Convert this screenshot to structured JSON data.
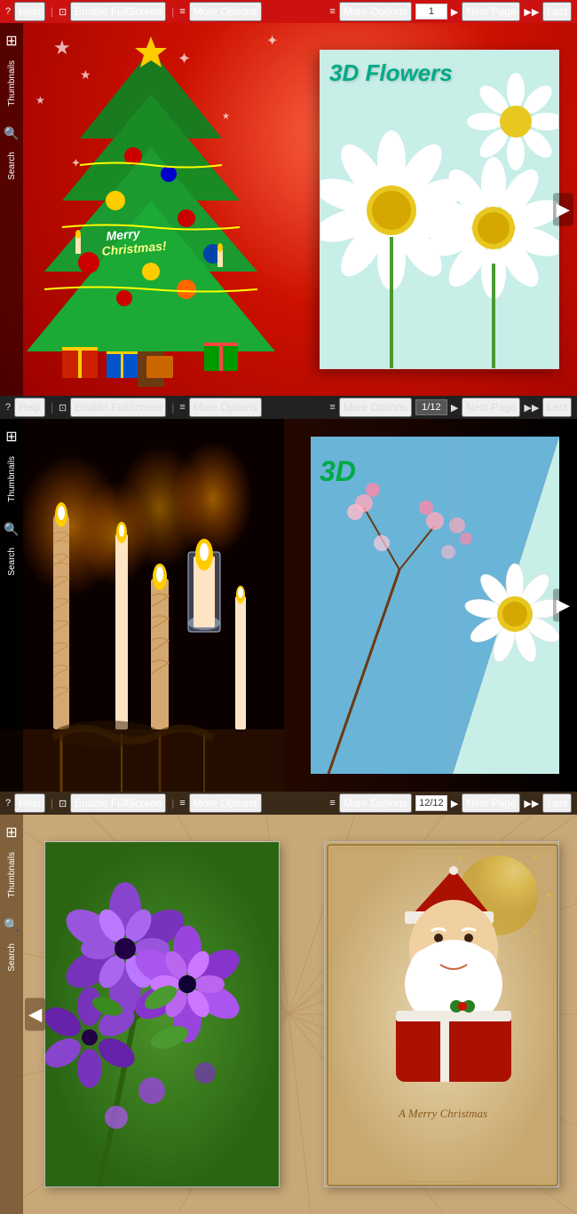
{
  "toolbar1": {
    "help_label": "Help",
    "fullscreen_label": "Enable FullScreen",
    "more_options_label1": "More Options",
    "more_options_label2": "More Options",
    "page_value": "1",
    "next_page_label": "Next Page",
    "last_label": "Last"
  },
  "toolbar2": {
    "help_label": "Help",
    "fullscreen_label": "Enable FullScreen",
    "more_options_label1": "More Options",
    "more_options_label2": "More Options",
    "page_value": "1/12",
    "next_page_label": "Next Page",
    "last_label": "Last"
  },
  "toolbar3": {
    "help_label": "Help",
    "fullscreen_label": "Enable FullScreen",
    "more_options_label1": "More Options",
    "more_options_label2": "More Options",
    "page_value": "12/12",
    "next_page_label": "Next Page",
    "last_label": "Last"
  },
  "sidebar1": {
    "thumbnails_label": "Thumbnails",
    "search_label": "Search"
  },
  "viewer1": {
    "title": "3D Flowers",
    "merry_christmas": "Merry Christmas!"
  },
  "viewer2": {
    "title": "3D"
  },
  "viewer3": {
    "merry_christmas": "A Merry Christmas"
  },
  "icons": {
    "help": "?",
    "fullscreen": "⊡",
    "options": "≡",
    "next": "▶",
    "last": "▶▶",
    "thumbnails": "⊞",
    "search": "🔍",
    "arrow_right": "▶",
    "arrow_left": "◀"
  }
}
